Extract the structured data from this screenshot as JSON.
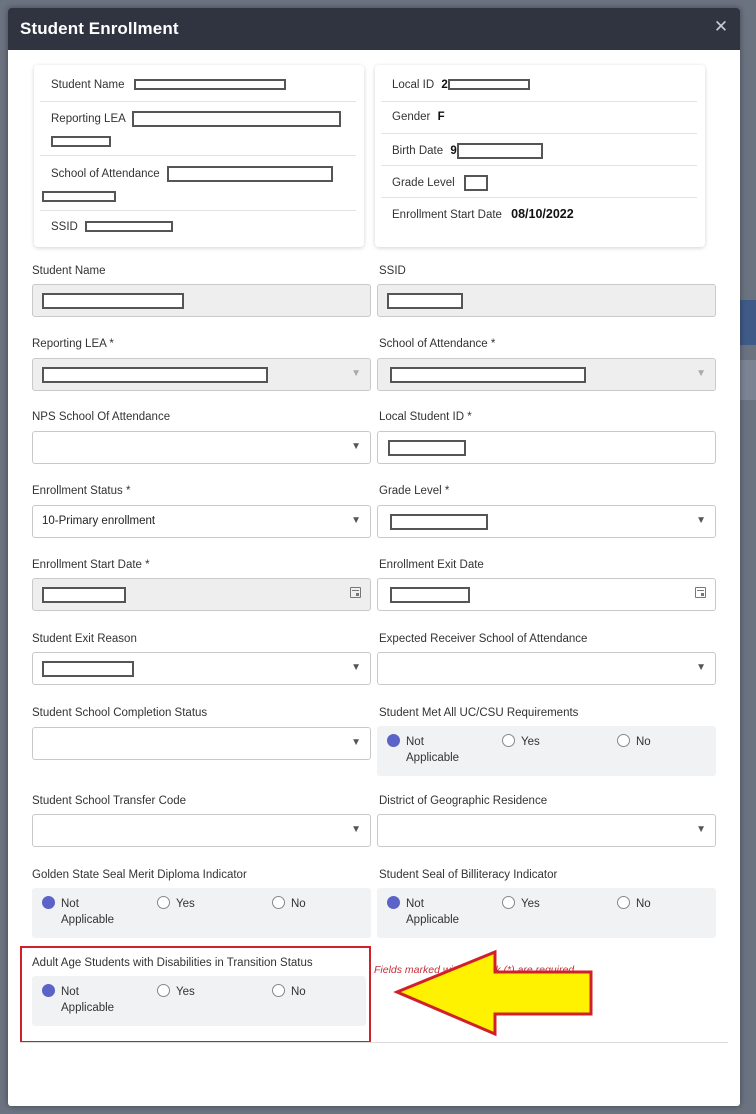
{
  "modal": {
    "title": "Student Enrollment",
    "close_icon": "close-icon"
  },
  "summary_left": {
    "student_name_label": "Student Name",
    "reporting_lea_label": "Reporting LEA",
    "school_label": "School of Attendance",
    "ssid_label": "SSID"
  },
  "summary_right": {
    "local_id_label": "Local ID",
    "local_id_prefix": "2",
    "gender_label": "Gender",
    "gender_value": "F",
    "birth_date_label": "Birth Date",
    "birth_date_prefix": "9",
    "grade_level_label": "Grade Level",
    "enrollment_start_label": "Enrollment Start Date",
    "enrollment_start_value": "08/10/2022"
  },
  "form": {
    "student_name": "Student Name",
    "ssid": "SSID",
    "reporting_lea": "Reporting LEA *",
    "school_of_attendance": "School of Attendance *",
    "nps_school": "NPS School Of Attendance",
    "local_student_id": "Local Student ID *",
    "enrollment_status": "Enrollment Status *",
    "enrollment_status_value": "10-Primary enrollment",
    "grade_level": "Grade Level *",
    "enrollment_start_date": "Enrollment Start Date *",
    "enrollment_exit_date": "Enrollment Exit Date",
    "student_exit_reason": "Student Exit Reason",
    "expected_receiver": "Expected Receiver School of Attendance",
    "completion_status": "Student School Completion Status",
    "uc_csu": "Student Met All UC/CSU Requirements",
    "transfer_code": "Student School Transfer Code",
    "district_residence": "District of Geographic Residence",
    "golden_state": "Golden State Seal Merit Diploma Indicator",
    "biliteracy": "Student Seal of Billiteracy Indicator",
    "adult_age": "Adult Age Students with Disabilities in Transition Status"
  },
  "radio": {
    "not": "Not",
    "applicable": "Applicable",
    "yes": "Yes",
    "no": "No"
  },
  "required_note": "Fields marked with asterisk (*) are required.",
  "colors": {
    "header": "#2f3440",
    "radio_selected": "#5b63c8",
    "highlight": "#d0202a",
    "arrow_fill": "#fff200"
  }
}
